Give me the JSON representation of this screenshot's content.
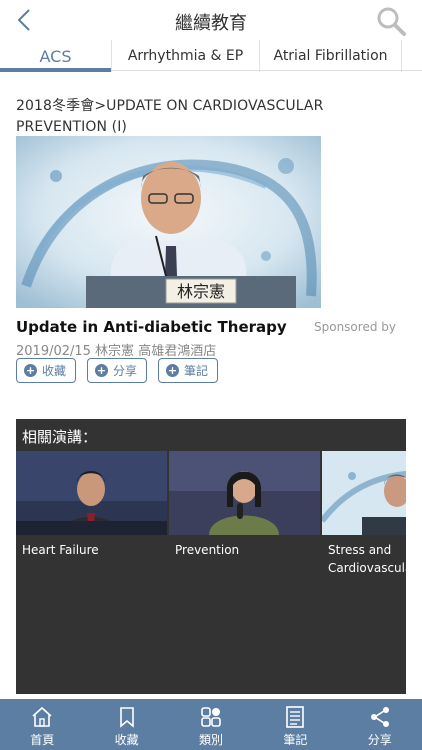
{
  "header": {
    "title": "繼續教育"
  },
  "tabs": [
    {
      "label": "ACS",
      "active": true
    },
    {
      "label": "Arrhythmia & EP",
      "active": false
    },
    {
      "label": "Atrial Fibrillation",
      "active": false
    }
  ],
  "video": {
    "header": "2018冬季會>UPDATE ON CARDIOVASCULAR PREVENTION (I)",
    "nameplate": "林宗憲",
    "title": "Update in Anti-diabetic Therapy",
    "sponsored": "Sponsored by",
    "meta": "2019/02/15 林宗憲 高雄君鴻酒店"
  },
  "actions": [
    {
      "label": "收藏"
    },
    {
      "label": "分享"
    },
    {
      "label": "筆記"
    }
  ],
  "related": {
    "title": "相關演講：",
    "items": [
      {
        "title": "Heart Failure"
      },
      {
        "title": "Prevention"
      },
      {
        "title": "Stress and Cardiovascula"
      }
    ]
  },
  "nav": [
    {
      "label": "首頁",
      "icon": "home-icon"
    },
    {
      "label": "收藏",
      "icon": "bookmark-icon"
    },
    {
      "label": "類別",
      "icon": "category-icon"
    },
    {
      "label": "筆記",
      "icon": "notes-icon"
    },
    {
      "label": "分享",
      "icon": "share-icon"
    }
  ],
  "colors": {
    "accent": "#5d7ea3",
    "panel": "#333333"
  }
}
